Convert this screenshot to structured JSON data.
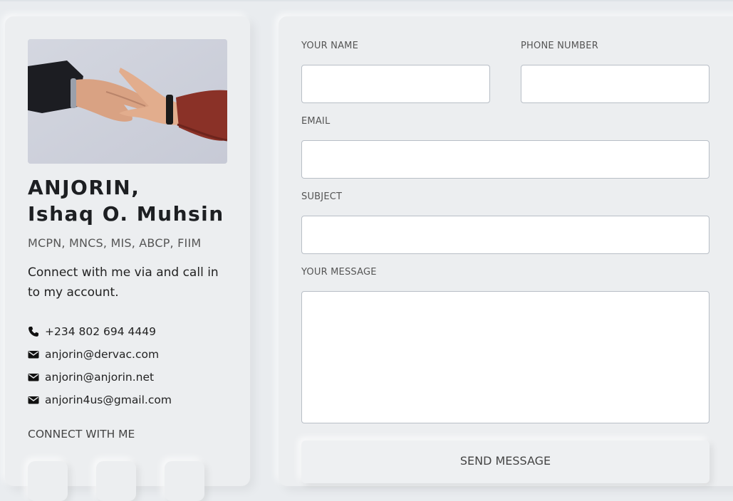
{
  "profile": {
    "name_line1": "ANJORIN,",
    "name_line2": "Ishaq O. Muhsin",
    "credentials": "MCPN, MNCS, MIS, ABCP, FIIM",
    "intro": "Connect with me via and call in to my account.",
    "contacts": [
      {
        "icon": "phone-icon",
        "text": "+234 802 694 4449"
      },
      {
        "icon": "envelope-icon",
        "text": "anjorin@dervac.com"
      },
      {
        "icon": "envelope-icon",
        "text": "anjorin@anjorin.net"
      },
      {
        "icon": "envelope-icon",
        "text": "anjorin4us@gmail.com"
      }
    ],
    "connect_heading": "CONNECT WITH ME"
  },
  "form": {
    "name_label": "YOUR NAME",
    "name_value": "",
    "phone_label": "PHONE NUMBER",
    "phone_value": "",
    "email_label": "EMAIL",
    "email_value": "",
    "subject_label": "SUBJECT",
    "subject_value": "",
    "message_label": "YOUR MESSAGE",
    "message_value": "",
    "send_label": "SEND MESSAGE"
  },
  "colors": {
    "background": "#e9ecef",
    "card": "#eceef0",
    "text": "#222222",
    "muted": "#555555"
  }
}
